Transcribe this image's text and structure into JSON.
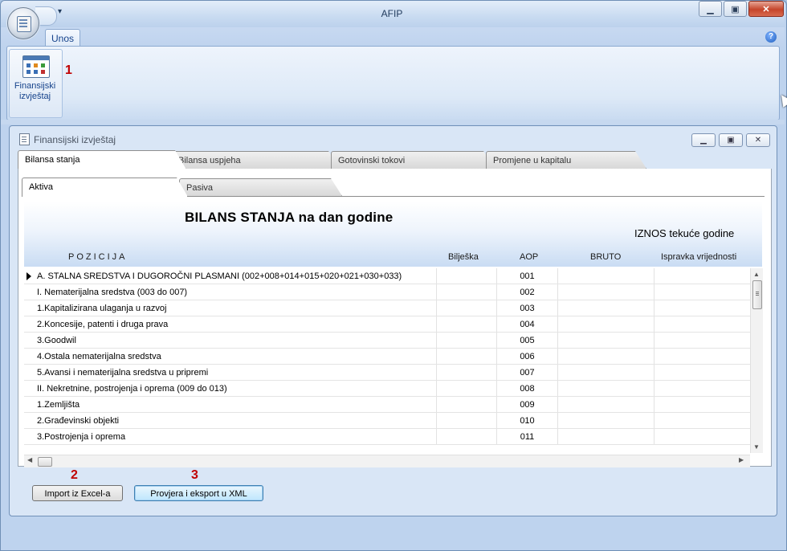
{
  "app": {
    "title": "AFIP"
  },
  "ribbon": {
    "tab": "Unos",
    "button_label_1": "Finansijski",
    "button_label_2": "izvještaj",
    "help": "?"
  },
  "annotations": {
    "one": "1",
    "two": "2",
    "three": "3"
  },
  "child_window": {
    "title": "Finansijski izvještaj"
  },
  "main_tabs": [
    "Bilansa stanja",
    "Bilansa uspjeha",
    "Gotovinski tokovi",
    "Promjene u kapitalu"
  ],
  "sub_tabs": [
    "Aktiva",
    "Pasiva"
  ],
  "report": {
    "title": "BILANS STANJA na dan godine",
    "subtitle": "IZNOS tekuće godine",
    "columns": {
      "pozicija": "POZICIJA",
      "biljeska": "Bilješka",
      "aop": "AOP",
      "bruto": "BRUTO",
      "ispravka": "Ispravka vrijednosti"
    }
  },
  "rows": [
    {
      "pozicija": "A. STALNA SREDSTVA I DUGOROČNI PLASMANI (002+008+014+015+020+021+030+033)",
      "aop": "001"
    },
    {
      "pozicija": "I. Nematerijalna sredstva (003 do 007)",
      "aop": "002"
    },
    {
      "pozicija": "1.Kapitalizirana ulaganja u razvoj",
      "aop": "003"
    },
    {
      "pozicija": "2.Koncesije, patenti i druga prava",
      "aop": "004"
    },
    {
      "pozicija": "3.Goodwil",
      "aop": "005"
    },
    {
      "pozicija": "4.Ostala nematerijalna sredstva",
      "aop": "006"
    },
    {
      "pozicija": "5.Avansi i nematerijalna sredstva u pripremi",
      "aop": "007"
    },
    {
      "pozicija": "II. Nekretnine, postrojenja i oprema (009 do 013)",
      "aop": "008"
    },
    {
      "pozicija": "1.Zemljišta",
      "aop": "009"
    },
    {
      "pozicija": "2.Građevinski objekti",
      "aop": "010"
    },
    {
      "pozicija": "3.Postrojenja i oprema",
      "aop": "011"
    }
  ],
  "buttons": {
    "import": "Import iz Excel-a",
    "export": "Provjera i eksport u XML"
  },
  "colors": {
    "accent": "#15428b",
    "annotation": "#c00000"
  }
}
